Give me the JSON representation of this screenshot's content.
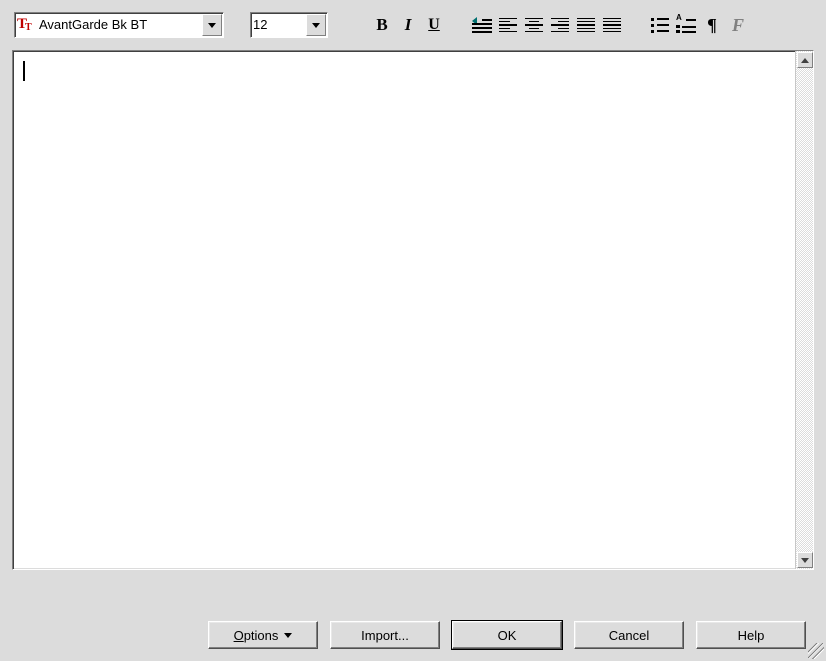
{
  "toolbar": {
    "font_name": "AvantGarde Bk BT",
    "font_size": "12"
  },
  "editor": {
    "content": ""
  },
  "buttons": {
    "options": "Options",
    "import": "Import...",
    "ok": "OK",
    "cancel": "Cancel",
    "help": "Help"
  }
}
